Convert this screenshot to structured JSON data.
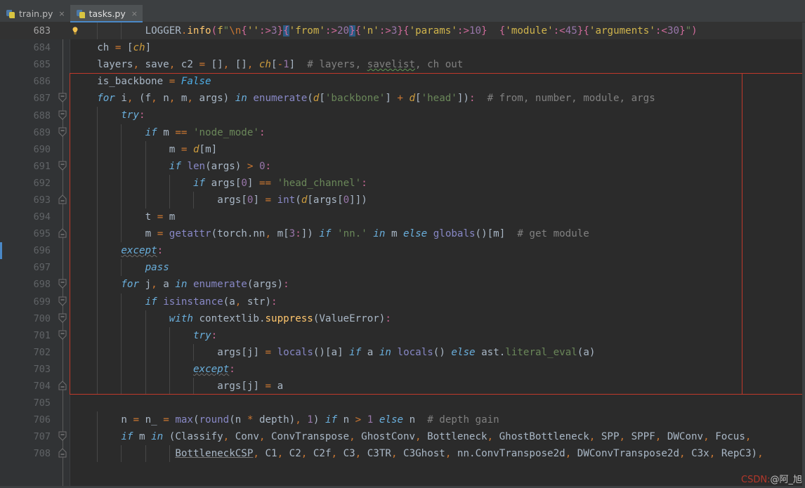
{
  "window": {
    "theme_bg": "#2b2b2b",
    "gutter_bg": "#313335",
    "accent": "#4a88c7",
    "annotation_color": "#c0392b"
  },
  "tabs": [
    {
      "label": "train.py",
      "icon": "python-file-icon",
      "active": false,
      "close": "×"
    },
    {
      "label": "tasks.py",
      "icon": "python-file-icon",
      "active": true,
      "close": "×"
    }
  ],
  "gutter": {
    "line_numbers": [
      "683",
      "684",
      "685",
      "686",
      "687",
      "688",
      "689",
      "690",
      "691",
      "692",
      "693",
      "694",
      "695",
      "696",
      "697",
      "698",
      "699",
      "700",
      "701",
      "702",
      "703",
      "704",
      "705",
      "706",
      "707",
      "708"
    ]
  },
  "editor": {
    "intention_bulb": "lightbulb-icon",
    "current_line": "683",
    "lines": [
      {
        "num": "683",
        "text": "            LOGGER.info(f\"\\n{'':>3}{'from':>20}{'n':>3}{'params':>10}  {'module':<45}{'arguments':<30}\")"
      },
      {
        "num": "684",
        "text": "    ch = [ch]"
      },
      {
        "num": "685",
        "text": "    layers, save, c2 = [], [], ch[-1]  # layers, savelist, ch out"
      },
      {
        "num": "686",
        "text": "    is_backbone = False"
      },
      {
        "num": "687",
        "text": "    for i, (f, n, m, args) in enumerate(d['backbone'] + d['head']):  # from, number, module, args"
      },
      {
        "num": "688",
        "text": "        try:"
      },
      {
        "num": "689",
        "text": "            if m == 'node_mode':"
      },
      {
        "num": "690",
        "text": "                m = d[m]"
      },
      {
        "num": "691",
        "text": "                if len(args) > 0:"
      },
      {
        "num": "692",
        "text": "                    if args[0] == 'head_channel':"
      },
      {
        "num": "693",
        "text": "                        args[0] = int(d[args[0]])"
      },
      {
        "num": "694",
        "text": "            t = m"
      },
      {
        "num": "695",
        "text": "            m = getattr(torch.nn, m[3:]) if 'nn.' in m else globals()[m]  # get module"
      },
      {
        "num": "696",
        "text": "        except:"
      },
      {
        "num": "697",
        "text": "            pass"
      },
      {
        "num": "698",
        "text": "        for j, a in enumerate(args):"
      },
      {
        "num": "699",
        "text": "            if isinstance(a, str):"
      },
      {
        "num": "700",
        "text": "                with contextlib.suppress(ValueError):"
      },
      {
        "num": "701",
        "text": "                    try:"
      },
      {
        "num": "702",
        "text": "                        args[j] = locals()[a] if a in locals() else ast.literal_eval(a)"
      },
      {
        "num": "703",
        "text": "                    except:"
      },
      {
        "num": "704",
        "text": "                        args[j] = a"
      },
      {
        "num": "705",
        "text": ""
      },
      {
        "num": "706",
        "text": "        n = n_ = max(round(n * depth), 1) if n > 1 else n  # depth gain"
      },
      {
        "num": "707",
        "text": "        if m in (Classify, Conv, ConvTranspose, GhostConv, Bottleneck, GhostBottleneck, SPP, SPPF, DWConv, Focus,"
      },
      {
        "num": "708",
        "text": "                 BottleneckCSP, C1, C2, C2f, C3, C3TR, C3Ghost, nn.ConvTranspose2d, DWConvTranspose2d, C3x, RepC3),"
      }
    ],
    "fold_markers": {
      "collapse": [
        "687",
        "688",
        "689",
        "691",
        "698",
        "699",
        "700",
        "701",
        "707"
      ],
      "end": [
        "693",
        "695",
        "704",
        "708"
      ]
    }
  },
  "annotation": {
    "shape": "rectangle",
    "color": "#c0392b",
    "covers_lines": "686-704"
  },
  "watermark": {
    "prefix": "CSDN",
    "separator": ":",
    "handle": "@阿_旭"
  }
}
